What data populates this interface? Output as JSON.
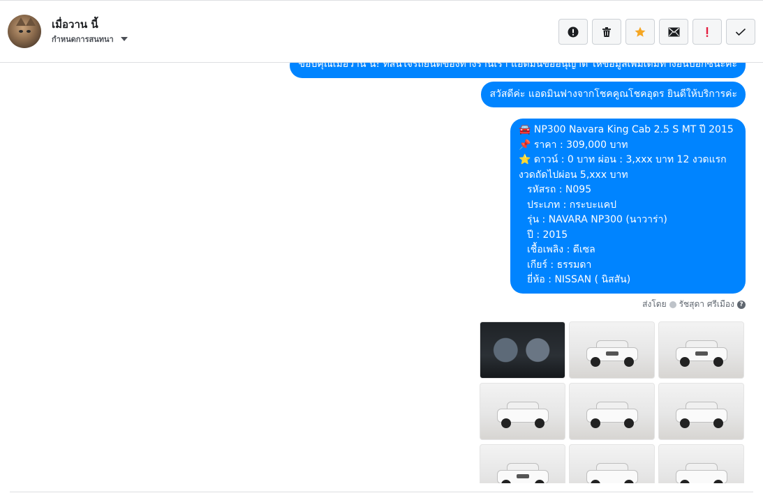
{
  "header": {
    "name": "เมื่อวาน นี้",
    "assign_label": "กำหนดการสนทนา"
  },
  "toolbar": {
    "buttons": [
      {
        "icon": "alert-circle-icon",
        "label": "Mark as spam"
      },
      {
        "icon": "trash-icon",
        "label": "Delete"
      },
      {
        "icon": "star-icon",
        "label": "Star",
        "color": "#f5a623"
      },
      {
        "icon": "envelope-icon",
        "label": "Mark as unread"
      },
      {
        "icon": "exclamation-icon",
        "label": "Follow up",
        "color": "#e41e3f"
      },
      {
        "icon": "check-icon",
        "label": "Done"
      }
    ]
  },
  "messages": {
    "m1": "ขอบคุณเมื่อวาน นี้! ที่สนใจรถยนต์ของทางร้านเรา แอดมินขออนุญาต ให้ข้อมูลเพิ่มเติมทางอินบ็อกซ์นะคะ",
    "m2": "สวัสดีค่ะ แอดมินฟางจากโชคคูณโชคอุดร ยินดีให้บริการค่ะ",
    "m3": {
      "l1": "🚘 NP300 Navara King Cab 2.5 S MT ปี 2015",
      "l2": "📌 ราคา : 309,000 บาท",
      "l3": "⭐ ดาวน์ : 0 บาท ผ่อน : 3,xxx บาท 12 งวดแรก",
      "l4": "งวดถัดไปผ่อน  5,xxx บาท",
      "l5": "รหัสรถ : N095",
      "l6": "ประเภท : กระบะแคป",
      "l7": "รุ่น : NAVARA NP300 (นาวาร่า)",
      "l8": "ปี : 2015",
      "l9": "เชื้อเพลิง : ดีเซล",
      "l10": "เกียร์ : ธรรมดา",
      "l11": "ยี่ห้อ : NISSAN ( นิสสัน)"
    }
  },
  "sent_by": {
    "prefix": "ส่งโดย",
    "name": "รัชสุดา ศรีเมือง"
  },
  "colors": {
    "bubble": "#0084ff",
    "star": "#f5a623",
    "exclaim": "#e41e3f"
  }
}
